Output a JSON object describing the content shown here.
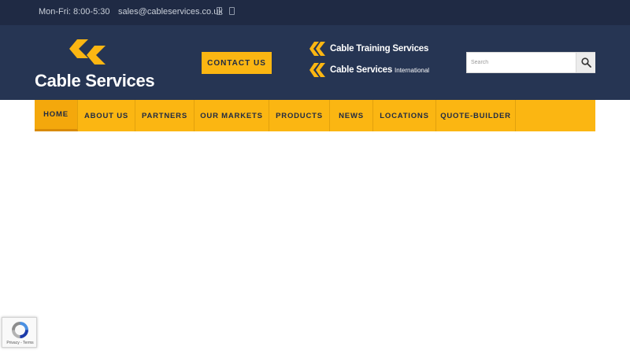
{
  "topbar": {
    "hours": "Mon-Fri: 8:00-5:30",
    "email": "sales@cableservices.co.uk",
    "social_icons": [
      "phone-icon",
      "mobile-icon"
    ]
  },
  "header": {
    "logo_text": "Cable Services",
    "contact_label": "CONTACT US",
    "partners": [
      {
        "name": "Cable Training Services",
        "sub": ""
      },
      {
        "name": "Cable Services",
        "sub": "International"
      }
    ],
    "search": {
      "placeholder": "Search",
      "icon": "search-icon"
    }
  },
  "nav": {
    "items": [
      {
        "label": "HOME",
        "active": true
      },
      {
        "label": "ABOUT US"
      },
      {
        "label": "PARTNERS"
      },
      {
        "label": "OUR MARKETS"
      },
      {
        "label": "PRODUCTS"
      },
      {
        "label": "NEWS"
      },
      {
        "label": "LOCATIONS"
      },
      {
        "label": "QUOTE-BUILDER"
      }
    ]
  },
  "recaptcha": {
    "terms": "Privacy - Terms"
  },
  "colors": {
    "accent": "#fbb612",
    "navy_dark": "#1f2a44",
    "navy": "#263553"
  }
}
